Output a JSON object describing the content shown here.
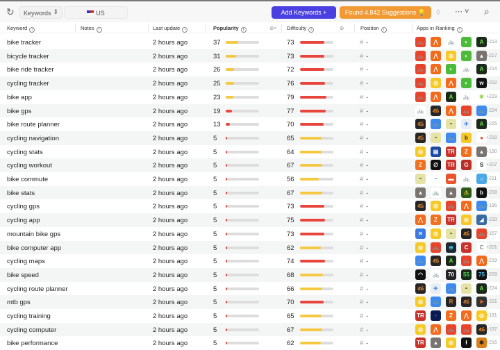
{
  "toolbar": {
    "refresh_icon": "refresh-icon",
    "mode_select": "Keywords",
    "country": "US",
    "add_keywords": "Add Keywords +",
    "suggestions": "Found 4.842 Suggestions 💡",
    "tag_icon": "tag-icon",
    "more_icon": "⋯ ˅",
    "search_icon": "search-icon"
  },
  "columns": {
    "keyword": "Keyword",
    "notes": "Notes",
    "last_update": "Last update",
    "popularity": "Popularity",
    "difficulty": "Difficulty",
    "position": "Position",
    "apps": "Apps in Ranking"
  },
  "colors": {
    "accent": "#4a3fe0",
    "suggest": "#f19a35",
    "high": "#e8453c",
    "low": "#f5c842"
  },
  "apps": {
    "red-bike": [
      "#e8442b",
      "#fff",
      "🚲"
    ],
    "strava": [
      "#f26a1b",
      "#fff",
      "⋀"
    ],
    "bike-outline": [
      "#fff",
      "#e9a84a",
      "🚲"
    ],
    "green": [
      "#4cbb3a",
      "#fff",
      "◐"
    ],
    "komoot": [
      "#1c2a1c",
      "#6ee04a",
      "A"
    ],
    "photo": [
      "#7a7470",
      "#fff",
      "▲"
    ],
    "yellow": [
      "#f6c928",
      "#fff",
      "◎"
    ],
    "wahoo": [
      "#111",
      "#fff",
      "w"
    ],
    "lime": [
      "#fff",
      "#8ad63a",
      "✻"
    ],
    "dark-bike": [
      "#262626",
      "#f08a2a",
      "ණ"
    ],
    "blue-bike": [
      "#3d8af0",
      "#fff",
      "🚲"
    ],
    "olive": [
      "#e6e3a8",
      "#5a6a2a",
      "◓"
    ],
    "map-blue": [
      "#e8eef5",
      "#3d7ae0",
      "✈"
    ],
    "yellow-b": [
      "#f6c928",
      "#222",
      "b"
    ],
    "pin": [
      "#fff",
      "#e8442b",
      "●"
    ],
    "tour": [
      "#1c4aa0",
      "#fff",
      "▤"
    ],
    "TR": [
      "#c8322b",
      "#fff",
      "TR"
    ],
    "Z": [
      "#f07020",
      "#fff",
      "Z"
    ],
    "spiral": [
      "#111",
      "#fff",
      "∅"
    ],
    "red-g": [
      "#b83028",
      "#fff",
      "G"
    ],
    "soul": [
      "#fff",
      "#222",
      "S"
    ],
    "ella": [
      "#fff",
      "#3d7ae0",
      "~"
    ],
    "orange-flat": [
      "#e8542b",
      "#fff",
      "▬"
    ],
    "blue-circle": [
      "#4aa8e8",
      "#fff",
      "○"
    ],
    "warning": [
      "#2a5a1a",
      "#f6c928",
      "⚠"
    ],
    "b": [
      "#111",
      "#fff",
      "b"
    ],
    "blue-photo": [
      "#3a6aa0",
      "#fff",
      "◢"
    ],
    "blue-x": [
      "#3d7ae0",
      "#fff",
      "✕"
    ],
    "dark-circle": [
      "#1a2a30",
      "#4ac0e0",
      "⊕"
    ],
    "red-C": [
      "#c8322b",
      "#fff",
      "C"
    ],
    "white-C": [
      "#fff",
      "#888",
      "C"
    ],
    "speedo": [
      "#111",
      "#fff",
      "◠"
    ],
    "speedo2": [
      "#222",
      "#fff",
      "70"
    ],
    "green55": [
      "#1a2a1a",
      "#4ce04a",
      "55"
    ],
    "blue75": [
      "#111",
      "#4ac0f0",
      "75"
    ],
    "dark-R": [
      "#262626",
      "#f08a2a",
      "R"
    ],
    "dark-arrow": [
      "#333",
      "#f0702a",
      "➤"
    ],
    "navy": [
      "#0c1a50",
      "#3d7af0",
      "♆"
    ],
    "figure": [
      "#111",
      "#fff",
      "ł"
    ],
    "orange-photo": [
      "#d8801a",
      "#222",
      "✱"
    ]
  },
  "rows": [
    {
      "keyword": "bike tracker",
      "updated": "2 hours ago",
      "popularity": 37,
      "difficulty": 73,
      "position": "-",
      "apps": [
        "red-bike",
        "strava",
        "bike-outline",
        "green",
        "komoot"
      ],
      "more": "+213"
    },
    {
      "keyword": "bicycle tracker",
      "updated": "2 hours ago",
      "popularity": 31,
      "difficulty": 73,
      "position": "-",
      "apps": [
        "red-bike",
        "strava",
        "yellow",
        "green",
        "photo"
      ],
      "more": "+217"
    },
    {
      "keyword": "bike ride tracker",
      "updated": "2 hours ago",
      "popularity": 26,
      "difficulty": 72,
      "position": "-",
      "apps": [
        "red-bike",
        "strava",
        "green",
        "bike-outline",
        "komoot"
      ],
      "more": "+214"
    },
    {
      "keyword": "cycling tracker",
      "updated": "2 hours ago",
      "popularity": 25,
      "difficulty": 76,
      "position": "-",
      "apps": [
        "red-bike",
        "yellow",
        "strava",
        "green",
        "wahoo"
      ],
      "more": "+222"
    },
    {
      "keyword": "bike app",
      "updated": "2 hours ago",
      "popularity": 23,
      "difficulty": 79,
      "position": "-",
      "apps": [
        "red-bike",
        "strava",
        "komoot",
        "bike-outline",
        "lime"
      ],
      "more": "+229"
    },
    {
      "keyword": "bike gps",
      "updated": "2 hours ago",
      "popularity": 19,
      "difficulty": 77,
      "position": "-",
      "apps": [
        "bike-outline",
        "dark-bike",
        "strava",
        "red-bike",
        "blue-bike"
      ],
      "more": "+224"
    },
    {
      "keyword": "bike route planner",
      "updated": "2 hours ago",
      "popularity": 13,
      "difficulty": 70,
      "position": "-",
      "apps": [
        "dark-bike",
        "blue-bike",
        "olive",
        "map-blue",
        "komoot"
      ],
      "more": "+225"
    },
    {
      "keyword": "cycling navigation",
      "updated": "2 hours ago",
      "popularity": 5,
      "difficulty": 65,
      "position": "-",
      "apps": [
        "dark-bike",
        "olive",
        "blue-bike",
        "yellow-b",
        "pin"
      ],
      "more": "+218"
    },
    {
      "keyword": "cycling stats",
      "updated": "2 hours ago",
      "popularity": 5,
      "difficulty": 64,
      "position": "-",
      "apps": [
        "yellow",
        "tour",
        "TR",
        "Z",
        "photo"
      ],
      "more": "+190"
    },
    {
      "keyword": "cycling workout",
      "updated": "2 hours ago",
      "popularity": 5,
      "difficulty": 67,
      "position": "-",
      "apps": [
        "Z",
        "spiral",
        "TR",
        "red-g",
        "soul"
      ],
      "more": "+207"
    },
    {
      "keyword": "bike commute",
      "updated": "2 hours ago",
      "popularity": 5,
      "difficulty": 56,
      "position": "-",
      "apps": [
        "olive",
        "ella",
        "orange-flat",
        "bike-outline",
        "blue-circle"
      ],
      "more": "+211"
    },
    {
      "keyword": "bike stats",
      "updated": "2 hours ago",
      "popularity": 5,
      "difficulty": 67,
      "position": "-",
      "apps": [
        "photo",
        "bike-outline",
        "photo",
        "warning",
        "b"
      ],
      "more": "+208"
    },
    {
      "keyword": "cycling gps",
      "updated": "2 hours ago",
      "popularity": 5,
      "difficulty": 73,
      "position": "-",
      "apps": [
        "dark-bike",
        "yellow",
        "red-bike",
        "strava",
        "blue-bike"
      ],
      "more": "+195"
    },
    {
      "keyword": "cycling app",
      "updated": "2 hours ago",
      "popularity": 5,
      "difficulty": 75,
      "position": "-",
      "apps": [
        "strava",
        "Z",
        "TR",
        "yellow",
        "blue-photo"
      ],
      "more": "+233"
    },
    {
      "keyword": "mountain bike gps",
      "updated": "2 hours ago",
      "popularity": 5,
      "difficulty": 73,
      "position": "-",
      "apps": [
        "blue-x",
        "yellow",
        "olive",
        "dark-bike",
        "red-bike"
      ],
      "more": "+167"
    },
    {
      "keyword": "bike computer app",
      "updated": "2 hours ago",
      "popularity": 5,
      "difficulty": 62,
      "position": "-",
      "apps": [
        "yellow",
        "red-bike",
        "dark-circle",
        "red-C",
        "white-C"
      ],
      "more": "+201"
    },
    {
      "keyword": "cycling maps",
      "updated": "2 hours ago",
      "popularity": 5,
      "difficulty": 74,
      "position": "-",
      "apps": [
        "blue-bike",
        "dark-bike",
        "komoot",
        "red-bike",
        "strava"
      ],
      "more": "+219"
    },
    {
      "keyword": "bike speed",
      "updated": "2 hours ago",
      "popularity": 5,
      "difficulty": 68,
      "position": "-",
      "apps": [
        "speedo",
        "bike-outline",
        "speedo2",
        "green55",
        "blue75"
      ],
      "more": "+209"
    },
    {
      "keyword": "cycling route planner",
      "updated": "2 hours ago",
      "popularity": 5,
      "difficulty": 66,
      "position": "-",
      "apps": [
        "dark-bike",
        "map-blue",
        "blue-bike",
        "olive",
        "komoot"
      ],
      "more": "+224"
    },
    {
      "keyword": "mtb gps",
      "updated": "2 hours ago",
      "popularity": 5,
      "difficulty": 70,
      "position": "-",
      "apps": [
        "yellow",
        "blue-bike",
        "dark-R",
        "dark-bike",
        "dark-arrow"
      ],
      "more": "+221"
    },
    {
      "keyword": "cycling training",
      "updated": "2 hours ago",
      "popularity": 5,
      "difficulty": 65,
      "position": "-",
      "apps": [
        "TR",
        "navy",
        "Z",
        "strava",
        "yellow"
      ],
      "more": "+191"
    },
    {
      "keyword": "cycling computer",
      "updated": "2 hours ago",
      "popularity": 5,
      "difficulty": 67,
      "position": "-",
      "apps": [
        "yellow",
        "strava",
        "red-bike",
        "red-bike",
        "dark-bike"
      ],
      "more": "+197"
    },
    {
      "keyword": "bike performance",
      "updated": "2 hours ago",
      "popularity": 5,
      "difficulty": 62,
      "position": "-",
      "apps": [
        "TR",
        "photo",
        "yellow",
        "figure",
        "orange-photo"
      ],
      "more": "+216"
    }
  ]
}
